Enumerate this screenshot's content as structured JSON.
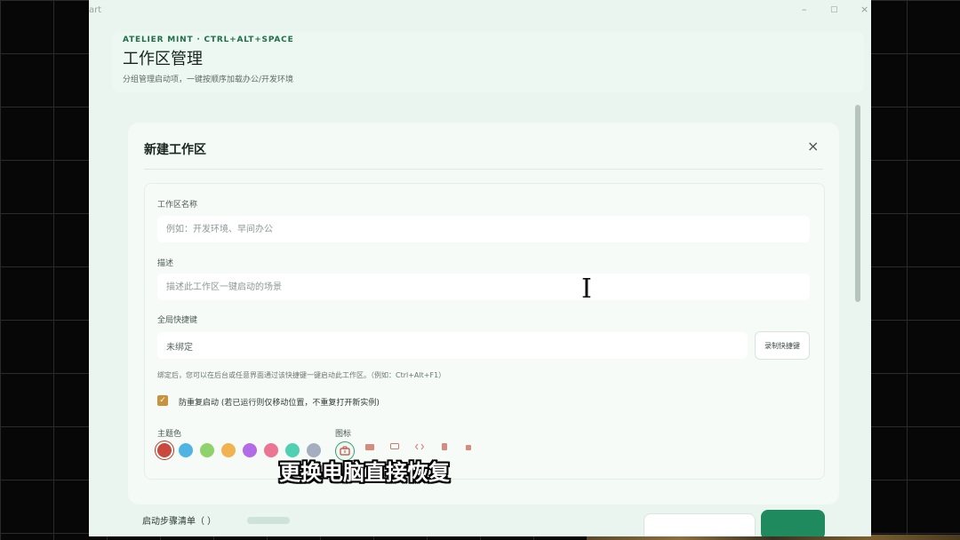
{
  "window": {
    "title_fragment": "art",
    "controls": {
      "minimize": "–",
      "maximize": "▢",
      "close": "×"
    }
  },
  "header": {
    "eyebrow": "ATELIER MINT · CTRL+ALT+SPACE",
    "title": "工作区管理",
    "subtitle": "分组管理启动项，一键按顺序加载办公/开发环境"
  },
  "modal": {
    "title": "新建工作区",
    "close_glyph": "×",
    "fields": {
      "name": {
        "label": "工作区名称",
        "placeholder": "例如：开发环境、早间办公"
      },
      "description": {
        "label": "描述",
        "placeholder": "描述此工作区一键启动的场景"
      },
      "hotkey": {
        "label": "全局快捷键",
        "value": "未绑定",
        "record_button": "录制快捷键",
        "helper": "绑定后，您可以在后台或任意界面通过该快捷键一键启动此工作区。（例如：Ctrl+Alt+F1）"
      }
    },
    "dedupe": {
      "checked": true,
      "label": "防重复启动 (若已运行则仅移动位置，不重复打开新实例)"
    },
    "theme_color": {
      "label": "主题色",
      "swatches": [
        "#c94a3d",
        "#4fb3e6",
        "#8fd16a",
        "#f0b34f",
        "#b46be6",
        "#ec7593",
        "#4fd0b2",
        "#a5aec0"
      ],
      "selected_index": 0
    },
    "icon": {
      "label": "图标",
      "selected": "briefcase-icon",
      "options": [
        "briefcase-icon",
        "folder-icon",
        "monitor-icon",
        "code-icon",
        "document-icon",
        "coffee-icon"
      ]
    }
  },
  "overlay": {
    "subtitle": "更换电脑直接恢复"
  },
  "below_fold": {
    "peek_text": "启动步骤清单（ ）"
  }
}
